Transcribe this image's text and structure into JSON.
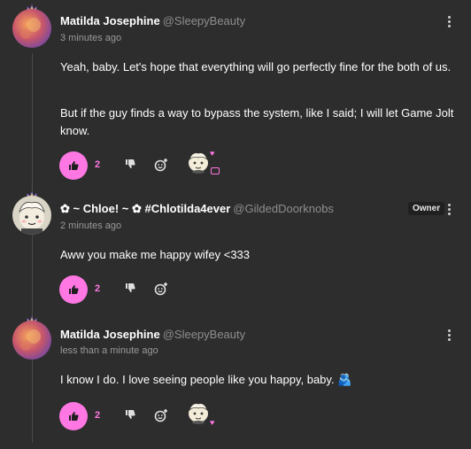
{
  "comments": [
    {
      "name": "Matilda Josephine",
      "handle": "@SleepyBeauty",
      "time": "3 minutes ago",
      "paragraphs": [
        "Yeah, baby. Let's hope that everything will go perfectly fine for the both of us.",
        "But if the guy finds a way to bypass the system, like I said; I will let Game Jolt know."
      ],
      "likes": "2"
    },
    {
      "name": "✿ ~ Chloe! ~ ✿ #Chlotilda4ever",
      "handle": "@GildedDoorknobs",
      "badge": "Owner",
      "time": "2 minutes ago",
      "paragraphs": [
        "Aww you make me happy wifey <333"
      ],
      "likes": "2"
    },
    {
      "name": "Matilda Josephine",
      "handle": "@SleepyBeauty",
      "time": "less than a minute ago",
      "paragraphs": [
        "I know I do. I love seeing people like you happy, baby. 🫂"
      ],
      "likes": "2"
    }
  ],
  "colors": {
    "background": "#2d2d2d",
    "accent": "#ff77e3",
    "muted": "#9a9a9a"
  },
  "icons": [
    "crown-icon",
    "thumbs-up-icon",
    "thumbs-down-icon",
    "add-reaction-icon",
    "more-options-icon",
    "heart-icon",
    "reply-icon"
  ]
}
